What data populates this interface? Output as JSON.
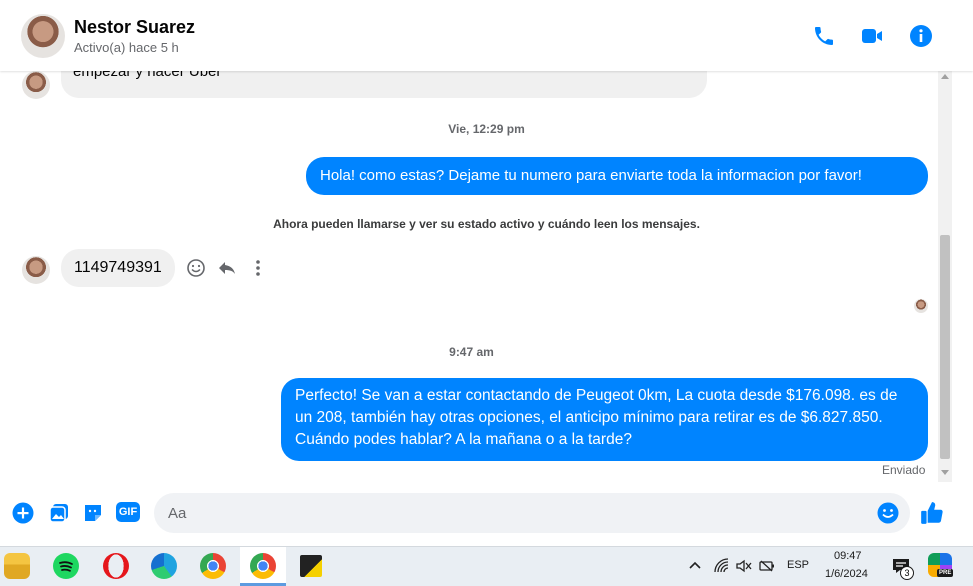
{
  "header": {
    "name": "Nestor Suarez",
    "status": "Activo(a) hace 5 h",
    "accent": "#0084ff"
  },
  "messages": {
    "m1": "empezar y hacer Uber",
    "ts1": "Vie, 12:29 pm",
    "m2": "Hola! como estas? Dejame tu numero para enviarte toda la informacion por favor!",
    "system": "Ahora pueden llamarse y ver su estado activo y cuándo leen los mensajes.",
    "m3": "1149749391",
    "ts2": "9:47 am",
    "m4": "Perfecto!  Se van a estar contactando de Peugeot 0km, La cuota desde $176.098. es de un 208, también hay otras opciones, el anticipo mínimo para retirar es de $6.827.850. Cuándo podes hablar? A la mañana o a la tarde?",
    "sent_status": "Enviado"
  },
  "composer": {
    "placeholder": "Aa",
    "gif_label": "GIF"
  },
  "taskbar": {
    "language": "ESP",
    "time": "09:47",
    "date": "1/6/2024",
    "notification_count": "3",
    "pre_badge": "PRE"
  }
}
